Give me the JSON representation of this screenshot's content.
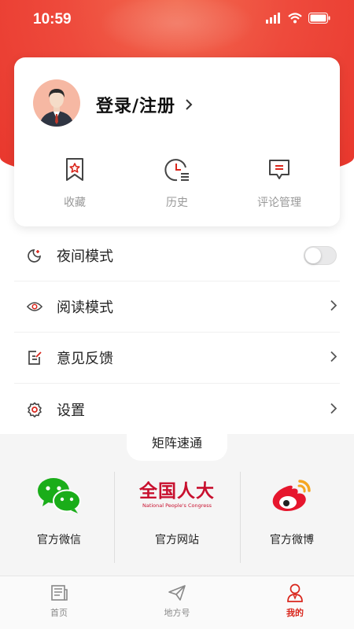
{
  "status_bar": {
    "time": "10:59"
  },
  "profile": {
    "login_label": "登录/注册",
    "quick_actions": [
      {
        "label": "收藏",
        "icon": "bookmark-star-icon"
      },
      {
        "label": "历史",
        "icon": "history-clock-icon"
      },
      {
        "label": "评论管理",
        "icon": "comment-icon"
      }
    ]
  },
  "menu": {
    "items": [
      {
        "label": "夜间模式",
        "icon": "night-mode-icon",
        "control": "toggle",
        "enabled": false
      },
      {
        "label": "阅读模式",
        "icon": "eye-icon",
        "control": "chevron"
      },
      {
        "label": "意见反馈",
        "icon": "feedback-icon",
        "control": "chevron"
      },
      {
        "label": "设置",
        "icon": "gear-icon",
        "control": "chevron"
      }
    ]
  },
  "matrix": {
    "title": "矩阵速通",
    "items": [
      {
        "label": "官方微信",
        "icon": "wechat-icon"
      },
      {
        "label": "官方网站",
        "icon": "npc-logo-icon",
        "logo_text": "全国人大",
        "logo_subtext": "National People's Congress"
      },
      {
        "label": "官方微博",
        "icon": "weibo-icon"
      }
    ]
  },
  "tabbar": {
    "tabs": [
      {
        "label": "首页",
        "icon": "newspaper-icon",
        "active": false
      },
      {
        "label": "地方号",
        "icon": "paper-plane-icon",
        "active": false
      },
      {
        "label": "我的",
        "icon": "user-icon",
        "active": true
      }
    ]
  },
  "colors": {
    "accent": "#d9261c",
    "header": "#ee4a3c",
    "wechat": "#1aad19",
    "weibo": "#e6162d"
  }
}
